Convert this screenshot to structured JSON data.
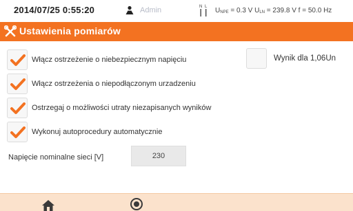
{
  "status_bar": {
    "datetime": "2014/07/25 0:55:20",
    "user": "Admin",
    "user_icon": "user-icon",
    "nl_icon": "phase-nl-icon",
    "u_npe_label": "U",
    "u_npe_sub": "NPE",
    "u_npe_value": " = 0.3 V ",
    "u_ln_label": "U",
    "u_ln_sub": "LN",
    "u_ln_value": " = 239.8 V ",
    "freq": "f = 50.0 Hz"
  },
  "header": {
    "title": "Ustawienia pomiarów",
    "icon": "settings-tools-icon",
    "accent_color": "#f37221"
  },
  "options": [
    {
      "label": "Włącz ostrzeżenie o niebezpiecznym napięciu",
      "checked": true
    },
    {
      "label": "Wynik dla 1,06Un",
      "checked": false
    },
    {
      "label": "Włącz ostrzeżenia o niepodłączonym urzadzeniu",
      "checked": true
    },
    {
      "label": "Ostrzegaj o możliwości utraty niezapisanych wyników",
      "checked": true
    },
    {
      "label": "Wykonuj autoprocedury automatycznie",
      "checked": true
    }
  ],
  "nominal_voltage": {
    "label": "Napięcie nominalne sieci [V]",
    "value": "230"
  },
  "bottom_nav": {
    "home_icon": "home-icon",
    "record_icon": "record-icon"
  }
}
